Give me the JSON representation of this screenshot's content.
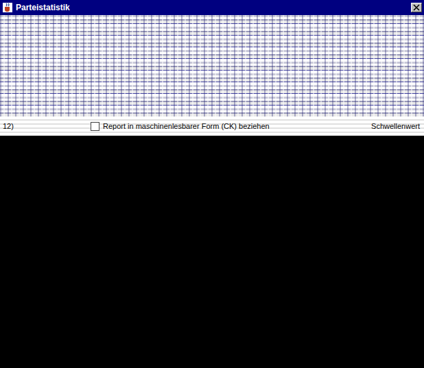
{
  "window": {
    "title": "Parteistatistik"
  },
  "options": [
    {
      "number": "12)",
      "label": "Report in maschinenlesbarer Form (CK) beziehen",
      "checked": false,
      "side_label": "Schwellenwert"
    }
  ]
}
